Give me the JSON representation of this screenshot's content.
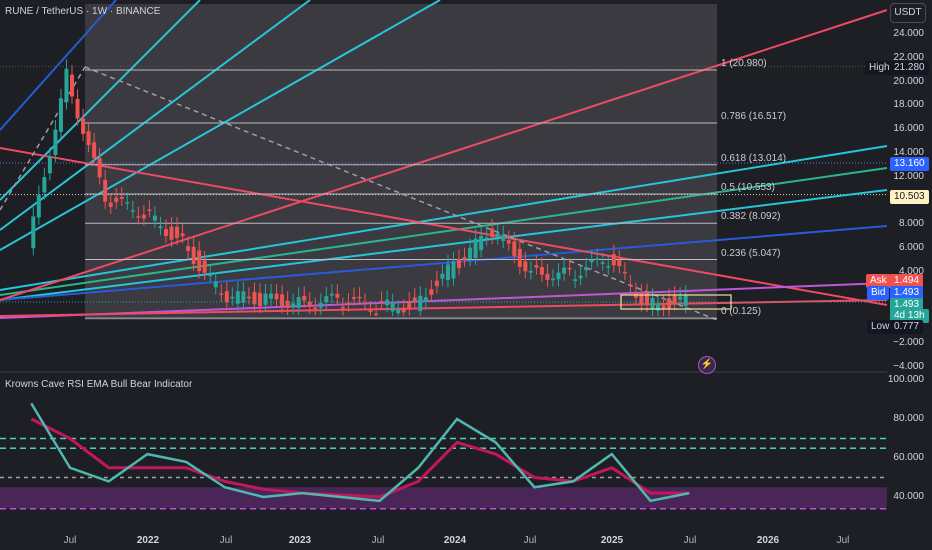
{
  "header": {
    "title": "RUNE / TetherUS · 1W · BINANCE"
  },
  "indicator": {
    "title": "Krowns Cave RSI EMA Bull Bear Indicator"
  },
  "currency_button": "USDT",
  "price_axis": [
    {
      "label": "24.000",
      "value": 24
    },
    {
      "label": "22.000",
      "value": 22
    },
    {
      "label": "20.000",
      "value": 20
    },
    {
      "label": "18.000",
      "value": 18
    },
    {
      "label": "16.000",
      "value": 16
    },
    {
      "label": "14.000",
      "value": 14
    },
    {
      "label": "12.000",
      "value": 12
    },
    {
      "label": "8.000",
      "value": 8
    },
    {
      "label": "6.000",
      "value": 6
    },
    {
      "label": "4.000",
      "value": 4
    },
    {
      "label": "−2.000",
      "value": -2
    },
    {
      "label": "−4.000",
      "value": -4
    }
  ],
  "rsi_axis": [
    {
      "label": "100.000",
      "value": 100
    },
    {
      "label": "80.000",
      "value": 80
    },
    {
      "label": "60.000",
      "value": 60
    },
    {
      "label": "40.000",
      "value": 40
    }
  ],
  "time_axis": [
    {
      "label": "Jul",
      "year": false
    },
    {
      "label": "2022",
      "year": true
    },
    {
      "label": "Jul",
      "year": false
    },
    {
      "label": "2023",
      "year": true
    },
    {
      "label": "Jul",
      "year": false
    },
    {
      "label": "2024",
      "year": true
    },
    {
      "label": "Jul",
      "year": false
    },
    {
      "label": "2025",
      "year": true
    },
    {
      "label": "Jul",
      "year": false
    },
    {
      "label": "2026",
      "year": true
    },
    {
      "label": "Jul",
      "year": false
    }
  ],
  "fib_levels": [
    {
      "label": "1 (20.980)",
      "value": 20.98
    },
    {
      "label": "0.786 (16.517)",
      "value": 16.517
    },
    {
      "label": "0.618 (13.014)",
      "value": 13.014
    },
    {
      "label": "0.5 (10.553)",
      "value": 10.553
    },
    {
      "label": "0.382 (8.092)",
      "value": 8.092
    },
    {
      "label": "0.236 (5.047)",
      "value": 5.047
    },
    {
      "label": "0 (0.125)",
      "value": 0.125
    }
  ],
  "badges": {
    "high_label": "High",
    "high_value": "21.280",
    "level1": "13.160",
    "level2": "10.503",
    "ask_label": "Ask",
    "ask_value": "1.494",
    "bid_label": "Bid",
    "bid_value": "1.493",
    "last_price": "1.493",
    "countdown": "4d 13h",
    "low_label": "Low",
    "low_value": "0.777"
  },
  "colors": {
    "background": "#1e1f24",
    "fib_zone": "#3a3a40",
    "bull": "#26a69a",
    "bear": "#ef5350",
    "rsi_line": "#4fb8b0",
    "ema_bull": "#2fb52f",
    "ema_bear": "#c2185b",
    "overbought": "#4dd0c4",
    "oversold_zone": "#5a2a6a"
  },
  "chart_data": [
    {
      "type": "candlestick",
      "title": "RUNE / TetherUS · 1W · BINANCE",
      "ylim": [
        -4,
        25
      ],
      "x": [
        "2021-04",
        "2021-07",
        "2021-10",
        "2022-01",
        "2022-04",
        "2022-07",
        "2022-10",
        "2023-01",
        "2023-04",
        "2023-07",
        "2023-10",
        "2024-01",
        "2024-04",
        "2024-07",
        "2024-10",
        "2025-01",
        "2025-04",
        "2025-07"
      ],
      "close": [
        6,
        20.5,
        10,
        9,
        6.5,
        2.0,
        1.7,
        1.5,
        1.6,
        1.0,
        1.3,
        4.5,
        7.5,
        4.0,
        3.8,
        5.0,
        1.3,
        1.5
      ],
      "high_marker": 21.28,
      "low_marker": 0.777,
      "last": 1.493
    },
    {
      "type": "line",
      "title": "Krowns Cave RSI EMA Bull Bear Indicator",
      "ylim": [
        30,
        100
      ],
      "x": [
        "2021-04",
        "2021-07",
        "2021-10",
        "2022-01",
        "2022-04",
        "2022-07",
        "2022-10",
        "2023-01",
        "2023-04",
        "2023-07",
        "2023-10",
        "2024-01",
        "2024-04",
        "2024-07",
        "2024-10",
        "2025-01",
        "2025-04",
        "2025-07"
      ],
      "series": [
        {
          "values": [
            88,
            55,
            48,
            62,
            58,
            45,
            40,
            42,
            40,
            38,
            55,
            80,
            68,
            45,
            48,
            62,
            38,
            42
          ]
        },
        {
          "values": [
            80,
            70,
            55,
            55,
            55,
            48,
            44,
            42,
            41,
            40,
            48,
            68,
            62,
            50,
            48,
            55,
            42,
            42
          ]
        }
      ],
      "hlines": [
        70,
        65,
        50,
        34
      ]
    }
  ]
}
